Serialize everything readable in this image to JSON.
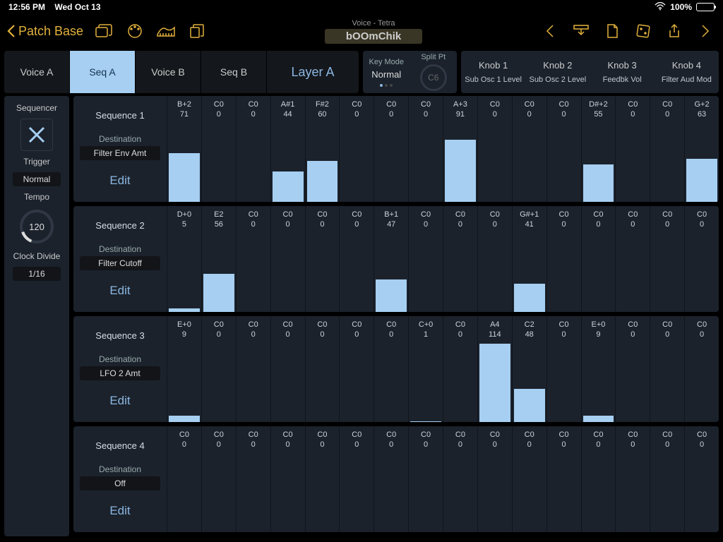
{
  "status": {
    "time": "12:56 PM",
    "date": "Wed Oct 13",
    "battery": "100%"
  },
  "toolbar": {
    "back": "Patch Base",
    "voice_sup": "Voice - Tetra",
    "patch": "bOOmChik"
  },
  "tabs": {
    "a": "Voice A",
    "b": "Seq A",
    "c": "Voice B",
    "d": "Seq B",
    "layer": "Layer A"
  },
  "keymode": {
    "lbl": "Key Mode",
    "val": "Normal",
    "split_lbl": "Split Pt",
    "split_val": "C6"
  },
  "knobs": [
    {
      "h": "Knob 1",
      "v": "Sub Osc 1 Level"
    },
    {
      "h": "Knob 2",
      "v": "Sub Osc 2 Level"
    },
    {
      "h": "Knob 3",
      "v": "Feedbk Vol"
    },
    {
      "h": "Knob 4",
      "v": "Filter Aud Mod"
    }
  ],
  "sidebar": {
    "sequencer": "Sequencer",
    "trigger": "Trigger",
    "trigger_val": "Normal",
    "tempo": "Tempo",
    "tempo_val": "120",
    "clock": "Clock Divide",
    "clock_val": "1/16"
  },
  "sequences": [
    {
      "title": "Sequence 1",
      "dst_lbl": "Destination",
      "dst": "Filter Env Amt",
      "edit": "Edit",
      "steps": [
        {
          "n": "B+2",
          "v": 71
        },
        {
          "n": "C0",
          "v": 0
        },
        {
          "n": "C0",
          "v": 0
        },
        {
          "n": "A#1",
          "v": 44
        },
        {
          "n": "F#2",
          "v": 60
        },
        {
          "n": "C0",
          "v": 0
        },
        {
          "n": "C0",
          "v": 0
        },
        {
          "n": "C0",
          "v": 0
        },
        {
          "n": "A+3",
          "v": 91
        },
        {
          "n": "C0",
          "v": 0
        },
        {
          "n": "C0",
          "v": 0
        },
        {
          "n": "C0",
          "v": 0
        },
        {
          "n": "D#+2",
          "v": 55
        },
        {
          "n": "C0",
          "v": 0
        },
        {
          "n": "C0",
          "v": 0
        },
        {
          "n": "G+2",
          "v": 63
        }
      ]
    },
    {
      "title": "Sequence 2",
      "dst_lbl": "Destination",
      "dst": "Filter Cutoff",
      "edit": "Edit",
      "steps": [
        {
          "n": "D+0",
          "v": 5
        },
        {
          "n": "E2",
          "v": 56
        },
        {
          "n": "C0",
          "v": 0
        },
        {
          "n": "C0",
          "v": 0
        },
        {
          "n": "C0",
          "v": 0
        },
        {
          "n": "C0",
          "v": 0
        },
        {
          "n": "B+1",
          "v": 47
        },
        {
          "n": "C0",
          "v": 0
        },
        {
          "n": "C0",
          "v": 0
        },
        {
          "n": "C0",
          "v": 0
        },
        {
          "n": "G#+1",
          "v": 41
        },
        {
          "n": "C0",
          "v": 0
        },
        {
          "n": "C0",
          "v": 0
        },
        {
          "n": "C0",
          "v": 0
        },
        {
          "n": "C0",
          "v": 0
        },
        {
          "n": "C0",
          "v": 0
        }
      ]
    },
    {
      "title": "Sequence 3",
      "dst_lbl": "Destination",
      "dst": "LFO 2 Amt",
      "edit": "Edit",
      "steps": [
        {
          "n": "E+0",
          "v": 9
        },
        {
          "n": "C0",
          "v": 0
        },
        {
          "n": "C0",
          "v": 0
        },
        {
          "n": "C0",
          "v": 0
        },
        {
          "n": "C0",
          "v": 0
        },
        {
          "n": "C0",
          "v": 0
        },
        {
          "n": "C0",
          "v": 0
        },
        {
          "n": "C+0",
          "v": 1
        },
        {
          "n": "C0",
          "v": 0
        },
        {
          "n": "A4",
          "v": 114
        },
        {
          "n": "C2",
          "v": 48
        },
        {
          "n": "C0",
          "v": 0
        },
        {
          "n": "E+0",
          "v": 9
        },
        {
          "n": "C0",
          "v": 0
        },
        {
          "n": "C0",
          "v": 0
        },
        {
          "n": "C0",
          "v": 0
        }
      ]
    },
    {
      "title": "Sequence 4",
      "dst_lbl": "Destination",
      "dst": "Off",
      "edit": "Edit",
      "steps": [
        {
          "n": "C0",
          "v": 0
        },
        {
          "n": "C0",
          "v": 0
        },
        {
          "n": "C0",
          "v": 0
        },
        {
          "n": "C0",
          "v": 0
        },
        {
          "n": "C0",
          "v": 0
        },
        {
          "n": "C0",
          "v": 0
        },
        {
          "n": "C0",
          "v": 0
        },
        {
          "n": "C0",
          "v": 0
        },
        {
          "n": "C0",
          "v": 0
        },
        {
          "n": "C0",
          "v": 0
        },
        {
          "n": "C0",
          "v": 0
        },
        {
          "n": "C0",
          "v": 0
        },
        {
          "n": "C0",
          "v": 0
        },
        {
          "n": "C0",
          "v": 0
        },
        {
          "n": "C0",
          "v": 0
        },
        {
          "n": "C0",
          "v": 0
        }
      ]
    }
  ]
}
